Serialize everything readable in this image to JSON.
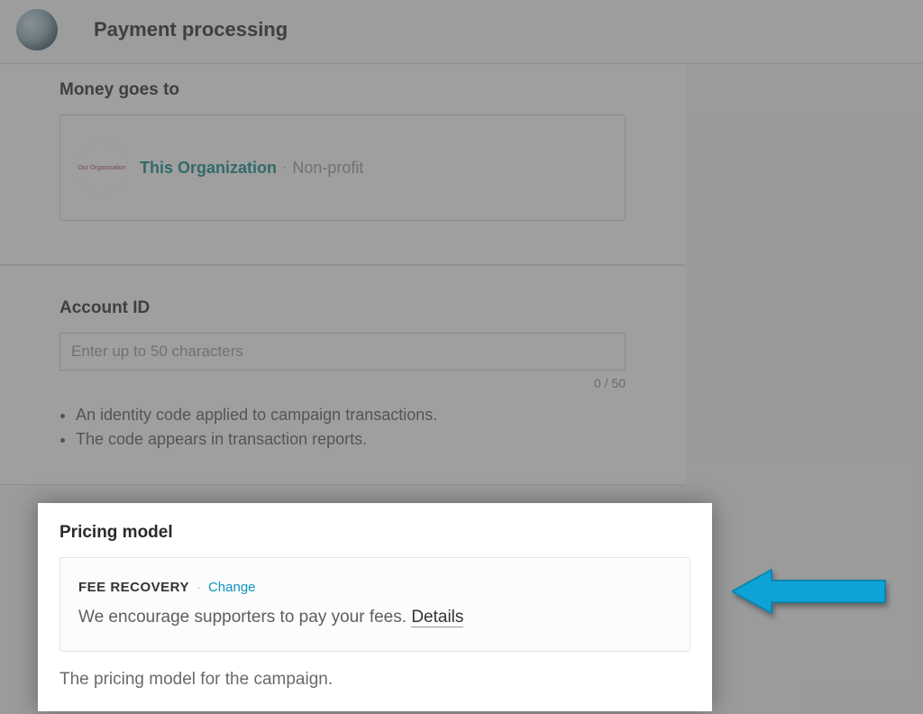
{
  "header": {
    "title": "Payment processing"
  },
  "money_section": {
    "heading": "Money goes to",
    "org_logo_text": "Our Organization",
    "org_name": "This Organization",
    "org_type": "Non-profit"
  },
  "account_section": {
    "heading": "Account ID",
    "placeholder": "Enter up to 50 characters",
    "value": "",
    "counter": "0 / 50",
    "bullet1": "An identity code applied to campaign transactions.",
    "bullet2": "The code appears in transaction reports."
  },
  "pricing_section": {
    "heading": "Pricing model",
    "model_name": "FEE RECOVERY",
    "change_label": "Change",
    "description_prefix": "We encourage supporters to pay your fees. ",
    "details_label": "Details",
    "caption": "The pricing model for the campaign."
  },
  "colors": {
    "arrow": "#0ea3d6"
  }
}
